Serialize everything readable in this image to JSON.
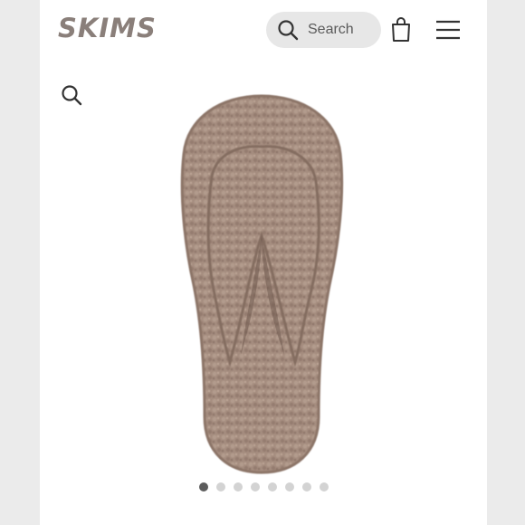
{
  "header": {
    "logo_text": "SKIMS",
    "search": {
      "label": "Search"
    }
  },
  "icons": {
    "search": "search-icon",
    "bag": "shopping-bag-icon",
    "menu": "hamburger-menu-icon",
    "zoom": "zoom-icon"
  },
  "gallery": {
    "image": "fuzzy-slipper-product-image",
    "total_images": 8,
    "active_index": 0
  },
  "colors": {
    "logo": "#8a7f7a",
    "search_bg": "#e7e7e7",
    "page_bg": "#ffffff",
    "outer_bg": "#ebebeb",
    "slipper": "#a58d7f",
    "dot_active": "#5c5c5c",
    "dot_inactive": "#d3d3d3"
  }
}
